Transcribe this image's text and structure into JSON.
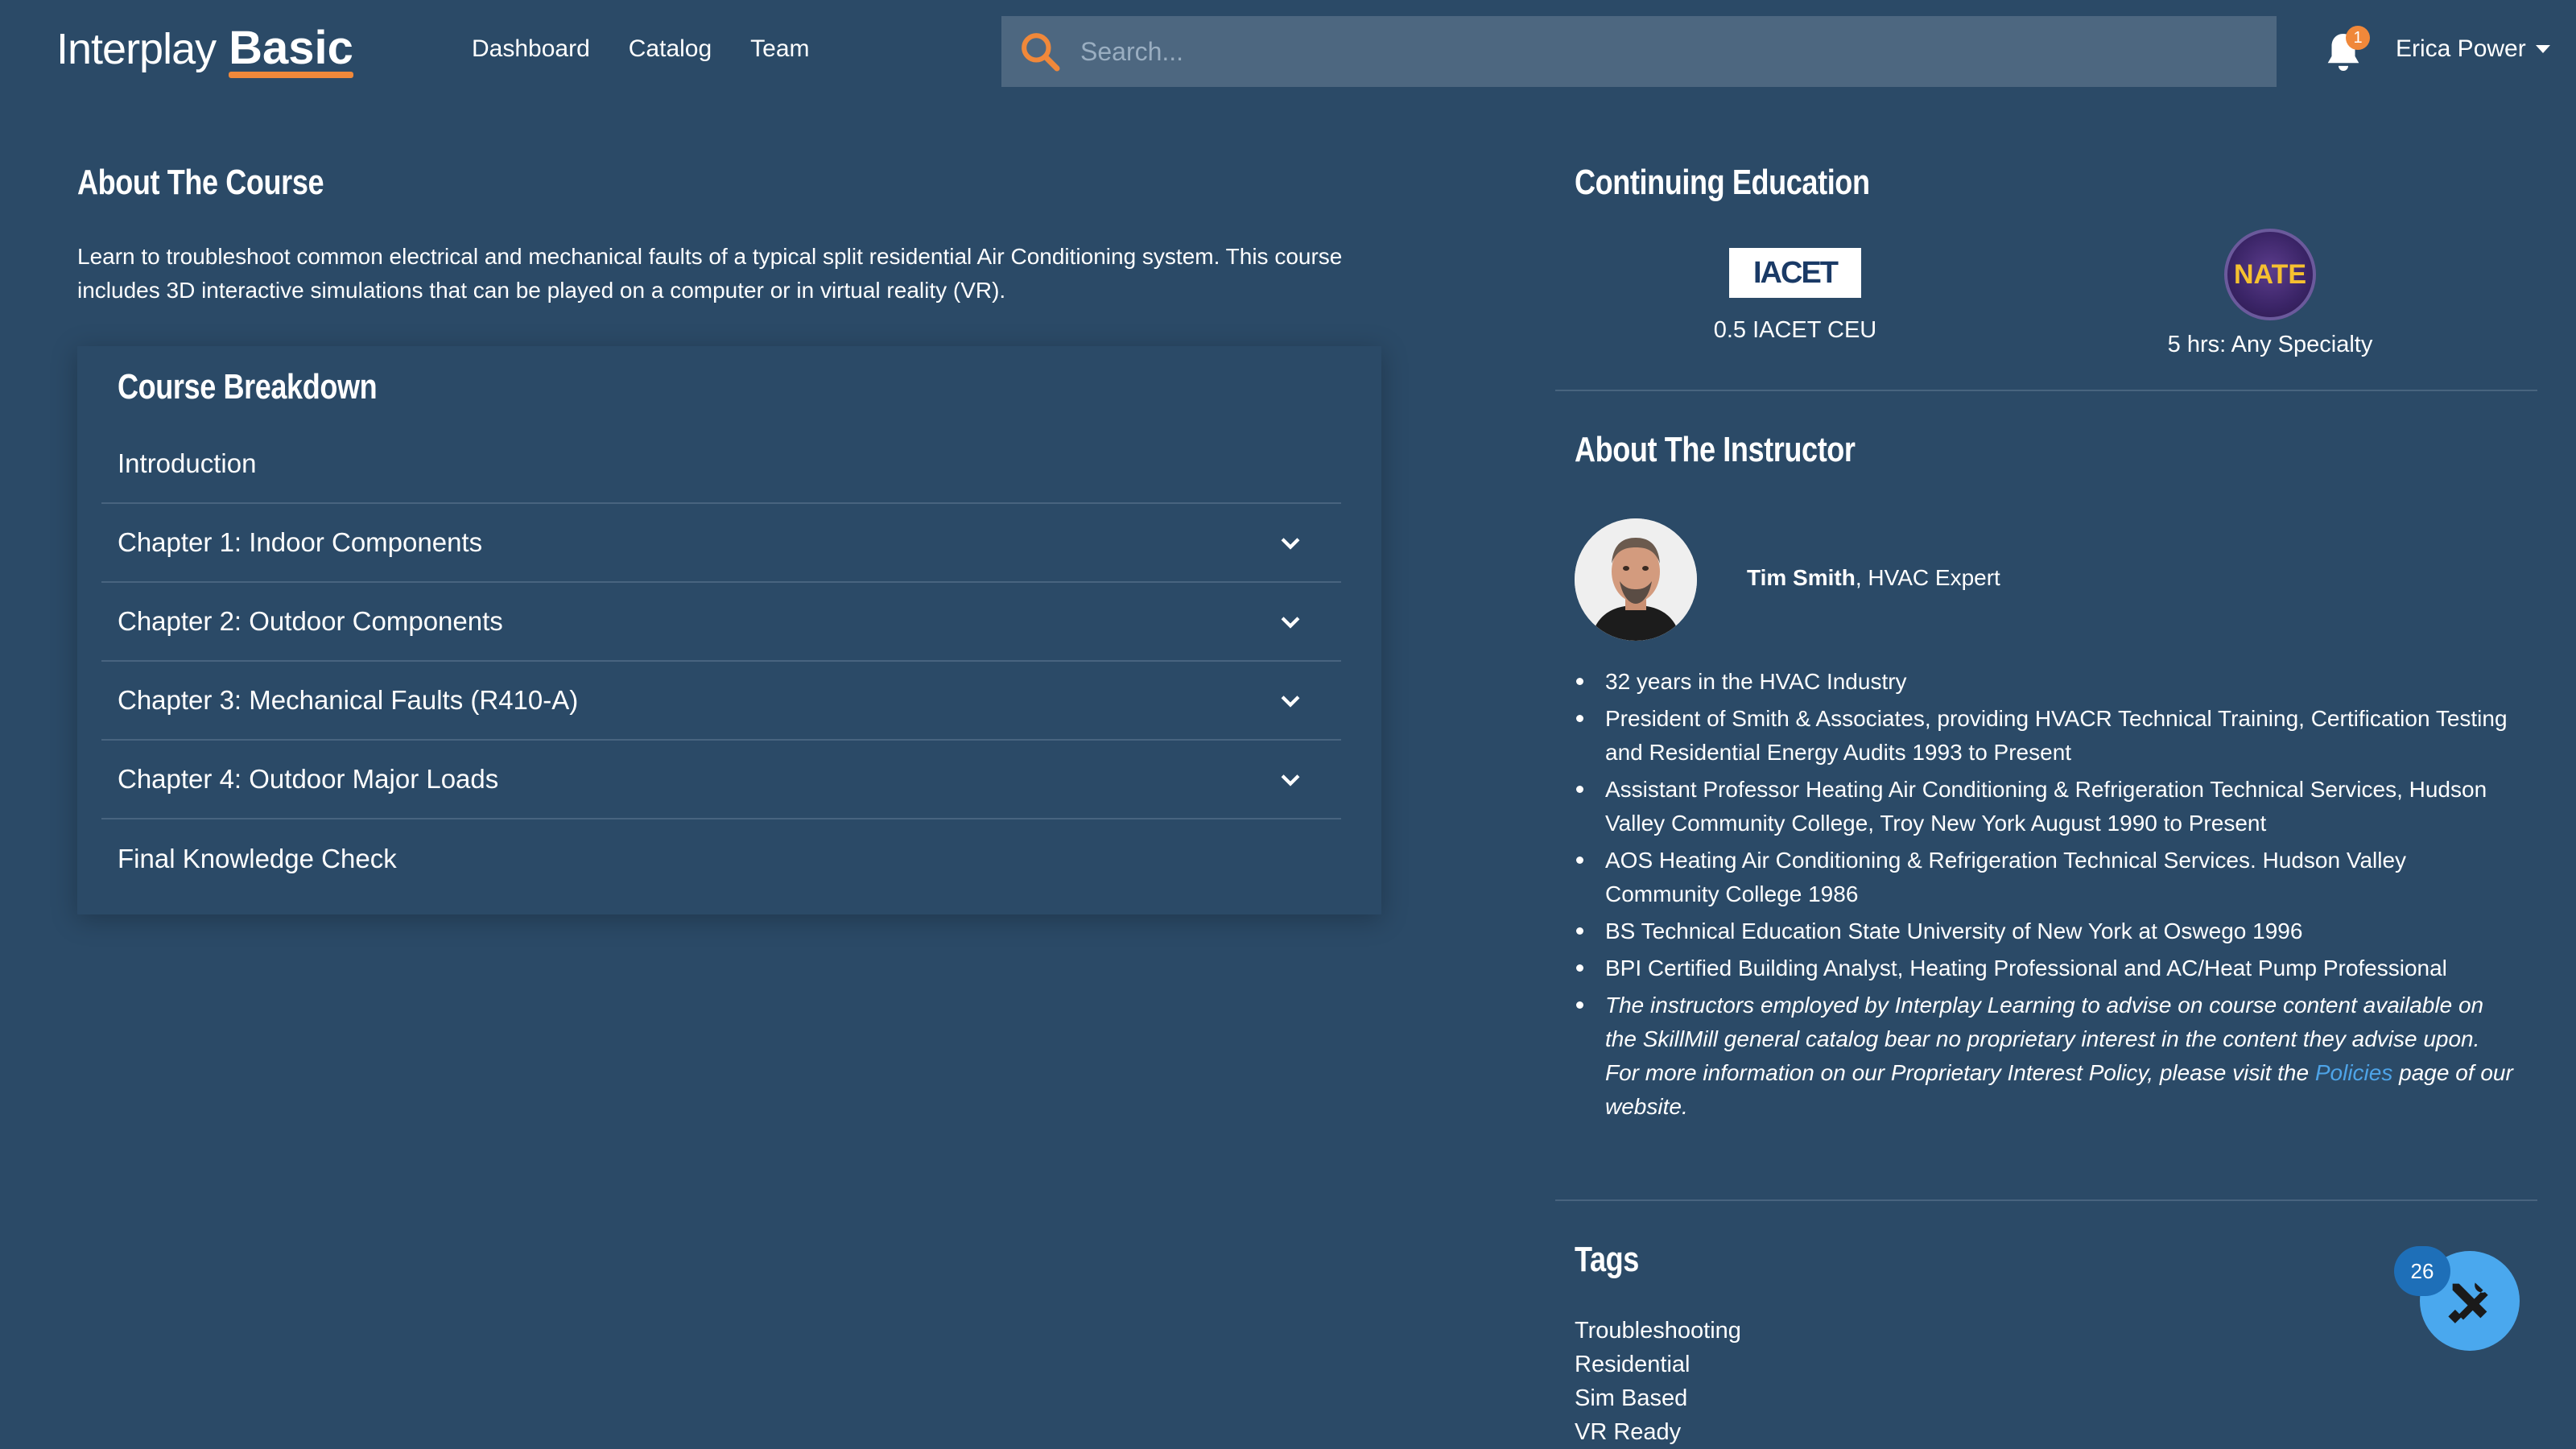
{
  "header": {
    "logo_main": "Interplay",
    "logo_sub": "Basic",
    "nav": [
      "Dashboard",
      "Catalog",
      "Team"
    ],
    "search_placeholder": "Search...",
    "notification_count": "1",
    "user_name": "Erica Power"
  },
  "about_course": {
    "title": "About The Course",
    "text": "Learn to troubleshoot common electrical and mechanical faults of a typical split residential Air Conditioning system. This course includes 3D interactive simulations that can be played on a computer or in virtual reality (VR)."
  },
  "breakdown": {
    "title": "Course Breakdown",
    "items": [
      {
        "label": "Introduction",
        "expandable": false
      },
      {
        "label": "Chapter 1: Indoor Components",
        "expandable": true
      },
      {
        "label": "Chapter 2: Outdoor Components",
        "expandable": true
      },
      {
        "label": "Chapter 3: Mechanical Faults (R410-A)",
        "expandable": true
      },
      {
        "label": "Chapter 4: Outdoor Major Loads",
        "expandable": true
      },
      {
        "label": "Final Knowledge Check",
        "expandable": false
      }
    ]
  },
  "continuing_education": {
    "title": "Continuing Education",
    "iacet_logo_text": "IACET",
    "iacet_label": "0.5 IACET CEU",
    "nate_logo_text": "NATE",
    "nate_label": "5 hrs: Any Specialty"
  },
  "instructor": {
    "title": "About The Instructor",
    "name": "Tim Smith",
    "role": ", HVAC Expert",
    "bullets": [
      "32 years in the HVAC Industry",
      "President of Smith & Associates, providing HVACR  Technical Training, Certification Testing and Residential Energy Audits 1993 to Present",
      "Assistant Professor Heating Air Conditioning & Refrigeration Technical Services, Hudson Valley Community College, Troy New York August 1990 to Present",
      "AOS Heating Air Conditioning & Refrigeration Technical Services. Hudson Valley Community College 1986",
      "BS Technical Education State University of New York at Oswego 1996",
      "BPI Certified Building Analyst, Heating Professional and AC/Heat Pump Professional"
    ],
    "disclaimer_before": "The instructors employed by Interplay Learning to advise on course content available on the SkillMill general catalog bear no proprietary interest in the content they advise upon. For more information on our Proprietary Interest Policy, please visit the ",
    "disclaimer_link": "Policies",
    "disclaimer_after": " page of our website."
  },
  "tags": {
    "title": "Tags",
    "items": [
      "Troubleshooting",
      "Residential",
      "Sim Based",
      "VR Ready"
    ]
  },
  "fab": {
    "badge": "26",
    "icon": "tools-icon"
  },
  "colors": {
    "background": "#2b4a67",
    "accent_orange": "#f0883a",
    "link_blue": "#4ea4e8",
    "fab_blue": "#4aa8ee"
  }
}
